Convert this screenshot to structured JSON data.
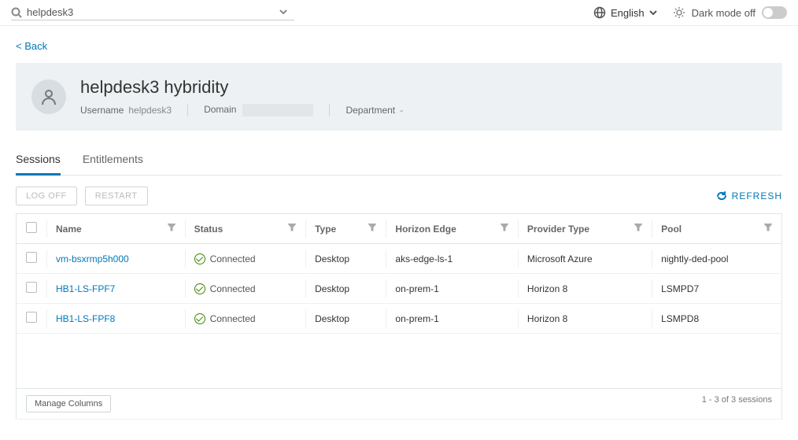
{
  "search": {
    "value": "helpdesk3"
  },
  "topbar": {
    "language": "English",
    "dark_label": "Dark mode off"
  },
  "nav": {
    "back": "< Back"
  },
  "profile": {
    "title": "helpdesk3 hybridity",
    "username_label": "Username",
    "username_value": "helpdesk3",
    "domain_label": "Domain",
    "domain_value": "",
    "department_label": "Department",
    "department_value": "-"
  },
  "tabs": {
    "sessions": "Sessions",
    "entitlements": "Entitlements"
  },
  "toolbar": {
    "logoff": "LOG OFF",
    "restart": "RESTART",
    "refresh": "REFRESH",
    "manage_columns": "Manage Columns"
  },
  "table": {
    "headers": {
      "name": "Name",
      "status": "Status",
      "type": "Type",
      "edge": "Horizon Edge",
      "provider": "Provider Type",
      "pool": "Pool"
    },
    "rows": [
      {
        "name": "vm-bsxrmp5h000",
        "status": "Connected",
        "type": "Desktop",
        "edge": "aks-edge-ls-1",
        "provider": "Microsoft Azure",
        "pool": "nightly-ded-pool"
      },
      {
        "name": "HB1-LS-FPF7",
        "status": "Connected",
        "type": "Desktop",
        "edge": "on-prem-1",
        "provider": "Horizon 8",
        "pool": "LSMPD7"
      },
      {
        "name": "HB1-LS-FPF8",
        "status": "Connected",
        "type": "Desktop",
        "edge": "on-prem-1",
        "provider": "Horizon 8",
        "pool": "LSMPD8"
      }
    ],
    "count_text": "1 - 3 of 3 sessions"
  }
}
